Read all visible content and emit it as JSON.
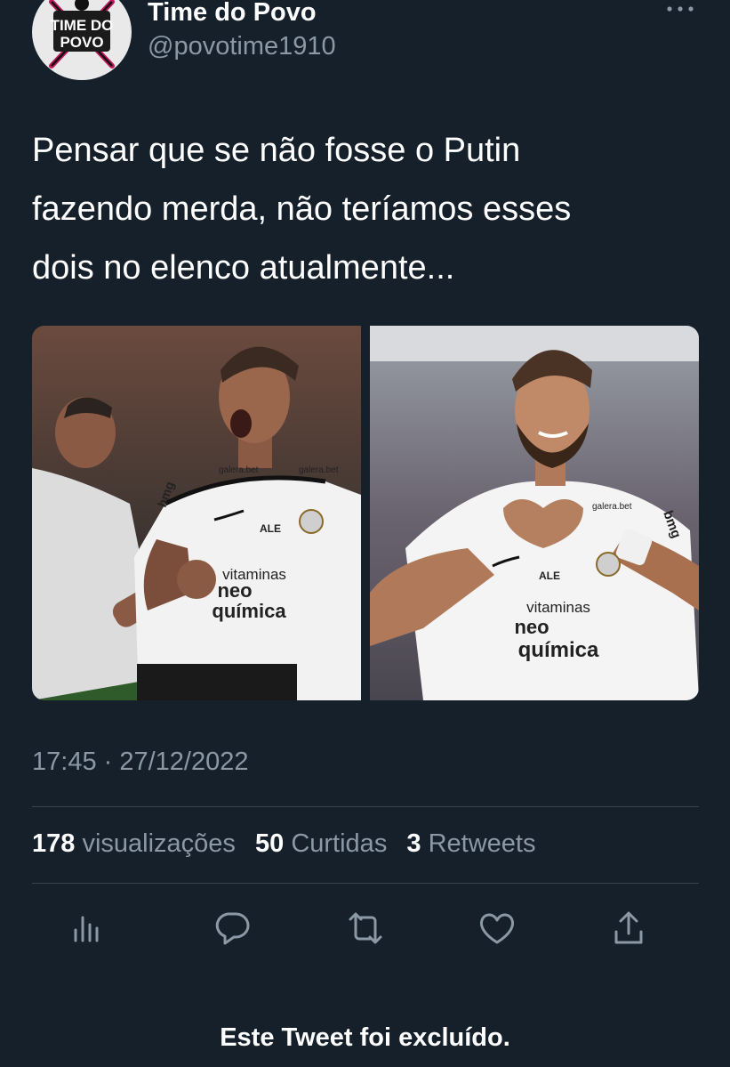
{
  "author": {
    "display_name": "Time do Povo",
    "handle": "@povotime1910",
    "avatar_text": [
      "TIME DO",
      "POVO"
    ]
  },
  "tweet": {
    "text_lines": [
      "Pensar que se não fosse o Putin",
      "fazendo merda, não teríamos esses",
      "dois no elenco atualmente..."
    ],
    "timestamp": "17:45 · 27/12/2022"
  },
  "media": {
    "left_photo": {
      "shirt_text": [
        "vitaminas",
        "neo",
        "química"
      ],
      "sponsor_marks": [
        "galera.bet",
        "bmg",
        "ALE"
      ]
    },
    "right_photo": {
      "shirt_text": [
        "vitaminas",
        "neo",
        "química"
      ],
      "sponsor_marks": [
        "galera.bet",
        "bmg",
        "ALE"
      ]
    }
  },
  "stats": {
    "views_count": "178",
    "views_label": "visualizações",
    "likes_count": "50",
    "likes_label": "Curtidas",
    "retweets_count": "3",
    "retweets_label": "Retweets"
  },
  "actions": [
    {
      "name": "analytics-icon"
    },
    {
      "name": "reply-icon"
    },
    {
      "name": "retweet-icon"
    },
    {
      "name": "like-icon"
    },
    {
      "name": "share-icon"
    }
  ],
  "footer": {
    "deleted_notice": "Este Tweet foi excluído."
  },
  "colors": {
    "background": "#15202b",
    "text_primary": "#ffffff",
    "text_secondary": "#8b98a5",
    "divider": "#38444d",
    "icon": "#8b98a5"
  }
}
